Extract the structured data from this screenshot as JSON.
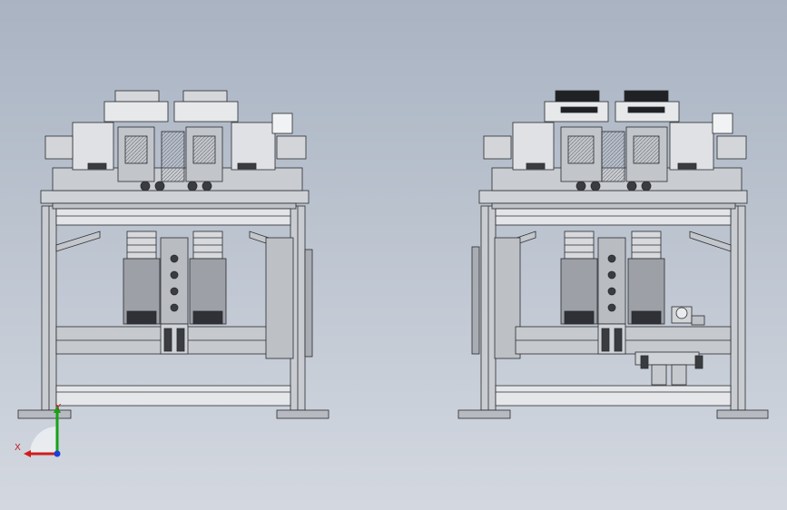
{
  "viewport": {
    "background_top": "#a9b3c2",
    "background_bottom": "#d3d8e0"
  },
  "triad": {
    "x_label": "X",
    "y_label": "Y",
    "x_color": "#d01c1c",
    "y_color": "#17a117",
    "z_color": "#1c3fd6"
  },
  "views": [
    {
      "name": "left-machine-view"
    },
    {
      "name": "right-machine-view"
    }
  ]
}
